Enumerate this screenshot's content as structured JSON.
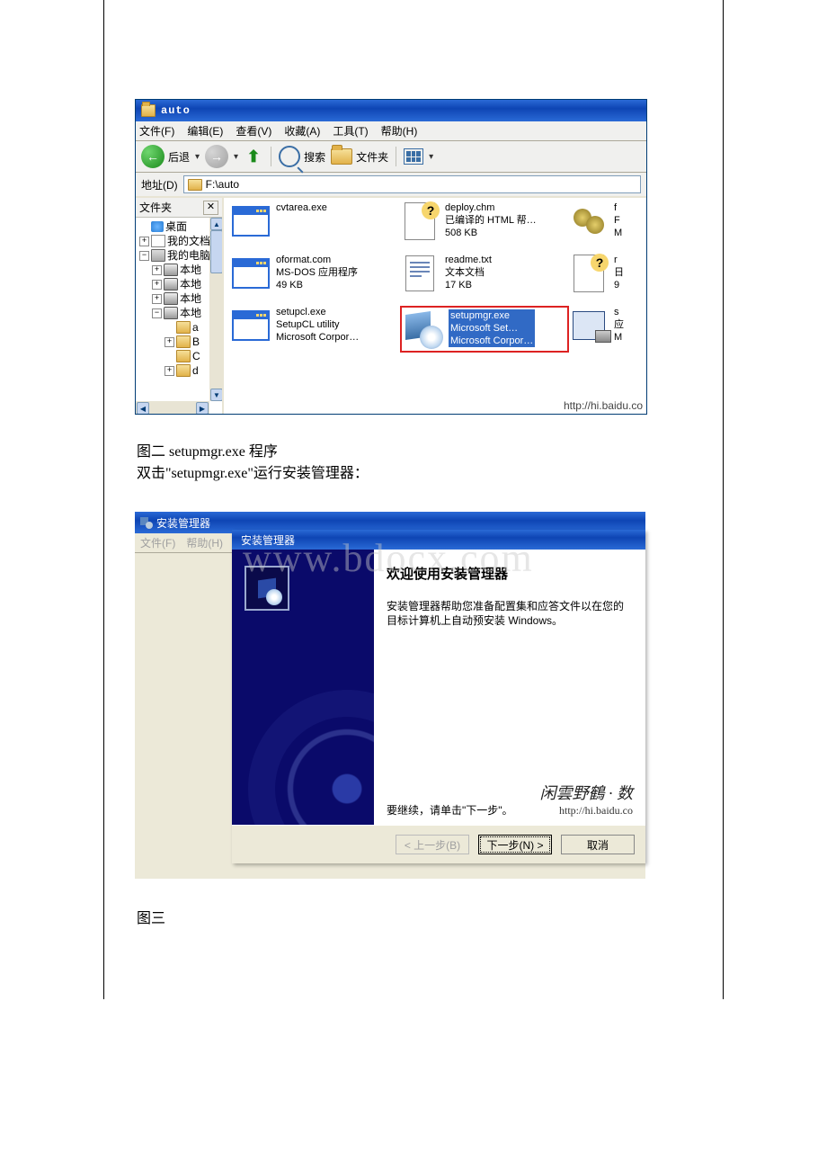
{
  "explorer": {
    "title": "auto",
    "menu": {
      "file": "文件(F)",
      "edit": "编辑(E)",
      "view": "查看(V)",
      "fav": "收藏(A)",
      "tools": "工具(T)",
      "help": "帮助(H)"
    },
    "toolbar": {
      "back": "后退",
      "search": "搜索",
      "folders": "文件夹"
    },
    "address": {
      "label": "地址(D)",
      "path": "F:\\auto"
    },
    "folders_pane": {
      "title": "文件夹"
    },
    "tree": {
      "desktop": "桌面",
      "mydocs": "我的文档",
      "mycomputer": "我的电脑",
      "local": "本地",
      "a": "a",
      "b": "B",
      "c": "C",
      "d": "d"
    },
    "files": [
      {
        "name": "cvtarea.exe",
        "l2": "",
        "l3": ""
      },
      {
        "name": "deploy.chm",
        "l2": "已编译的 HTML 帮…",
        "l3": "508 KB"
      },
      {
        "name": "f",
        "l2": "F",
        "l3": "M"
      },
      {
        "name": "oformat.com",
        "l2": "MS-DOS 应用程序",
        "l3": "49 KB"
      },
      {
        "name": "readme.txt",
        "l2": "文本文档",
        "l3": "17 KB"
      },
      {
        "name": "r",
        "l2": "日",
        "l3": "9"
      },
      {
        "name": "setupcl.exe",
        "l2": "SetupCL utility",
        "l3": "Microsoft Corpor…"
      },
      {
        "name": "setupmgr.exe",
        "l2": "Microsoft Set…",
        "l3": "Microsoft Corpor…"
      },
      {
        "name": "s",
        "l2": "应",
        "l3": "M"
      }
    ],
    "watermark_url": "http://hi.baidu.co"
  },
  "caption1_line1": "图二    setupmgr.exe 程序",
  "caption1_line2": "双击\"setupmgr.exe\"运行安装管理器：",
  "wizard": {
    "bg_title": "安装管理器",
    "bg_menu": {
      "file": "文件(F)",
      "help": "帮助(H)"
    },
    "fg_title": "安装管理器",
    "heading": "欢迎使用安装管理器",
    "body": "安装管理器帮助您准备配置集和应答文件以在您的目标计算机上自动预安装 Windows。",
    "continue": "要继续，请单击\"下一步\"。",
    "sig_line1": "闲雲野鶴 · 数",
    "sig_line2": "http://hi.baidu.co",
    "btn_prev": "< 上一步(B)",
    "btn_next": "下一步(N) >",
    "btn_cancel": "取消",
    "watermark": "www.bdocx.com"
  },
  "caption2": "图三"
}
